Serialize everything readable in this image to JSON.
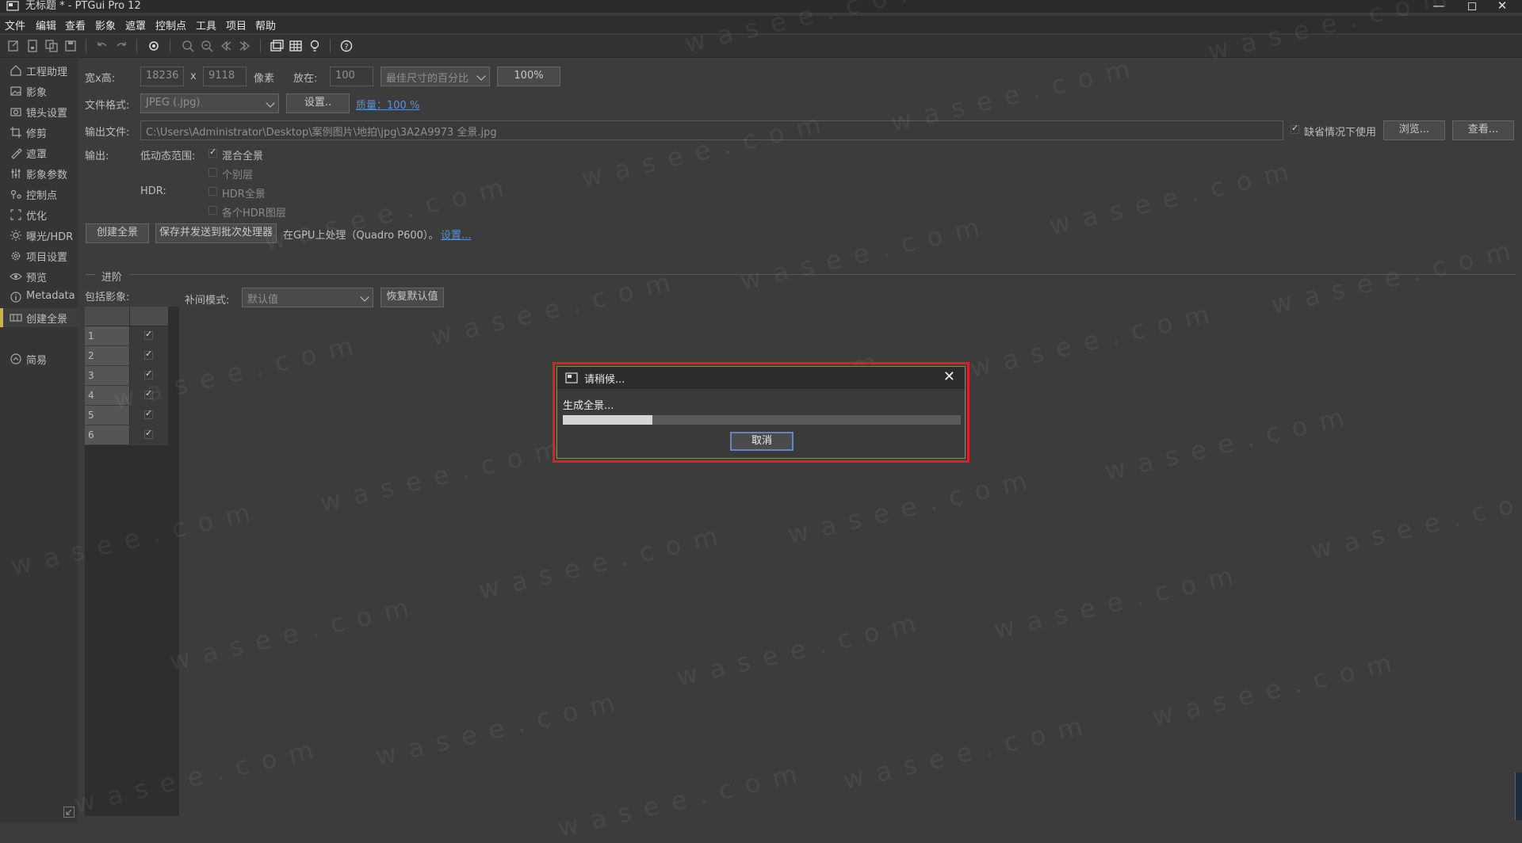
{
  "window": {
    "title": "无标题 * - PTGui Pro 12"
  },
  "menu": [
    "文件",
    "编辑",
    "查看",
    "影象",
    "遮罩",
    "控制点",
    "工具",
    "项目",
    "帮助"
  ],
  "sidebar": {
    "items": [
      {
        "label": "工程助理",
        "icon": "home-icon"
      },
      {
        "label": "影象",
        "icon": "image-icon"
      },
      {
        "label": "镜头设置",
        "icon": "camera-icon"
      },
      {
        "label": "修剪",
        "icon": "crop-icon"
      },
      {
        "label": "遮罩",
        "icon": "brush-icon"
      },
      {
        "label": "影象参数",
        "icon": "sliders-icon"
      },
      {
        "label": "控制点",
        "icon": "pin-icon"
      },
      {
        "label": "优化",
        "icon": "optimize-icon"
      },
      {
        "label": "曝光/HDR",
        "icon": "sun-icon"
      },
      {
        "label": "项目设置",
        "icon": "gear-icon"
      },
      {
        "label": "预览",
        "icon": "eye-icon"
      },
      {
        "label": "Metadata",
        "icon": "info-icon"
      },
      {
        "label": "创建全景",
        "icon": "panorama-icon"
      }
    ],
    "simple_label": "简易"
  },
  "size": {
    "label": "宽x高:",
    "width": "18236",
    "x": "x",
    "height": "9118",
    "unit": "像素",
    "scale_label": "放在:",
    "scale_value": "100",
    "scale_mode": "最佳尺寸的百分比",
    "percent_button": "100%"
  },
  "format": {
    "label": "文件格式:",
    "value": "JPEG (.jpg)",
    "settings_button": "设置..",
    "quality_link": "质量：100 %"
  },
  "output_file": {
    "label": "输出文件:",
    "path": "C:\\Users\\Administrator\\Desktop\\案例图片\\地拍\\jpg\\3A2A9973 全景.jpg",
    "default_label": "缺省情况下使用",
    "browse_button": "浏览...",
    "view_button": "查看..."
  },
  "output": {
    "label": "输出:",
    "ldr_label": "低动态范围:",
    "blended": "混合全景",
    "individual_layers": "个别层",
    "hdr_label": "HDR:",
    "hdr_panorama": "HDR全景",
    "hdr_layers": "各个HDR图层"
  },
  "actions": {
    "create_button": "创建全景",
    "save_batch_button": "保存并发送到批次处理器",
    "gpu_text": "在GPU上处理（Quadro P600）。",
    "gpu_settings_link": "设置..."
  },
  "advanced": {
    "section_label": "进阶",
    "include_images_label": "包括影象:",
    "interp_label": "补间模式:",
    "interp_value": "默认值",
    "restore_button": "恢复默认值",
    "rows": [
      "1",
      "2",
      "3",
      "4",
      "5",
      "6"
    ]
  },
  "dialog": {
    "title": "请稍候...",
    "message": "生成全景...",
    "progress": 0.225,
    "cancel_button": "取消"
  },
  "watermark": "wasee.com"
}
